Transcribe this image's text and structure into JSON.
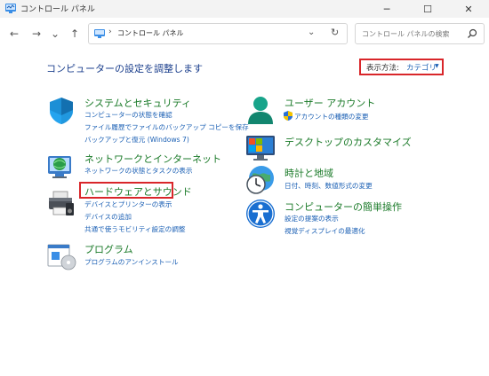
{
  "window": {
    "title": "コントロール パネル",
    "minimize": "─",
    "maximize": "☐",
    "close": "✕"
  },
  "nav": {
    "back": "←",
    "forward": "→",
    "recent": "⌄",
    "up": "↑"
  },
  "address": {
    "path": "コントロール パネル",
    "chevron": "›",
    "dropdown": "⌄",
    "refresh": "↻"
  },
  "search": {
    "placeholder": "コントロール パネルの検索"
  },
  "main": {
    "heading": "コンピューターの設定を調整します",
    "view_by_label": "表示方法:",
    "view_by_value": "カテゴリ",
    "view_by_caret": "▼"
  },
  "categories_left": [
    {
      "title": "システムとセキュリティ",
      "links": [
        "コンピューターの状態を確認",
        "ファイル履歴でファイルのバックアップ コピーを保存",
        "バックアップと復元 (Windows 7)"
      ]
    },
    {
      "title": "ネットワークとインターネット",
      "links": [
        "ネットワークの状態とタスクの表示"
      ]
    },
    {
      "title": "ハードウェアとサウンド",
      "links": [
        "デバイスとプリンターの表示",
        "デバイスの追加",
        "共通で使うモビリティ設定の調整"
      ]
    },
    {
      "title": "プログラム",
      "links": [
        "プログラムのアンインストール"
      ]
    }
  ],
  "categories_right": [
    {
      "title": "ユーザー アカウント",
      "links": [
        "アカウントの種類の変更"
      ]
    },
    {
      "title": "デスクトップのカスタマイズ",
      "links": []
    },
    {
      "title": "時計と地域",
      "links": [
        "日付、時刻、数値形式の変更"
      ]
    },
    {
      "title": "コンピューターの簡単操作",
      "links": [
        "設定の提案の表示",
        "視覚ディスプレイの最適化"
      ]
    }
  ],
  "colors": {
    "category_title": "#1a7a28",
    "link": "#1a5fb4",
    "highlight": "#d9262a"
  }
}
